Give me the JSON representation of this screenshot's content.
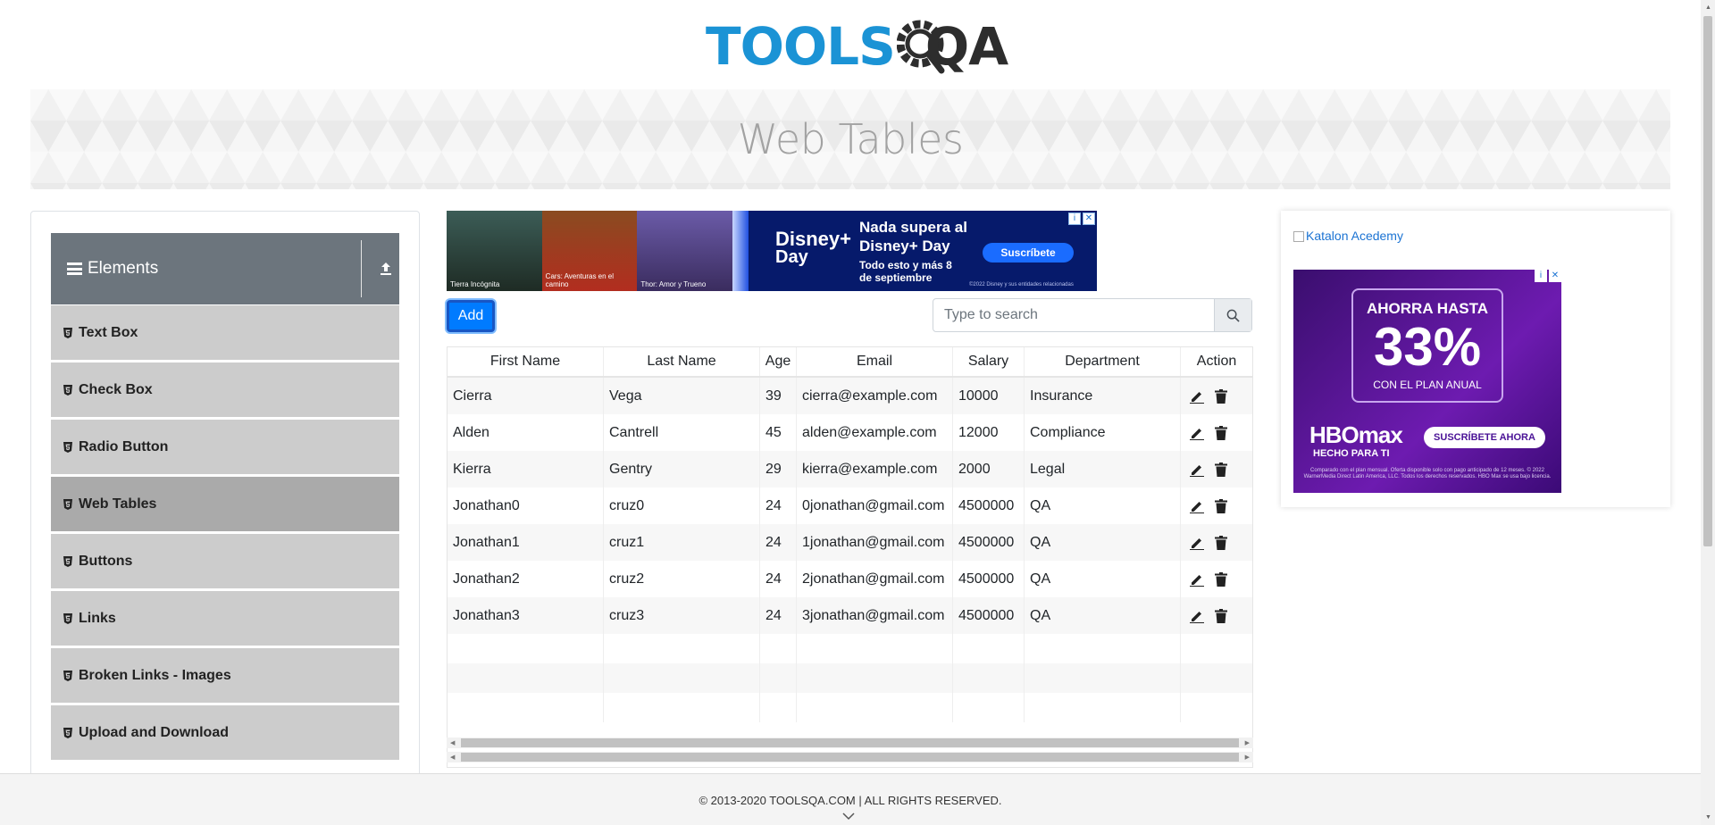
{
  "logo": {
    "part1": "TOOLS",
    "part2": "QA"
  },
  "page_title": "Web Tables",
  "sidebar": {
    "group_title": "Elements",
    "items": [
      {
        "label": "Text Box",
        "active": false
      },
      {
        "label": "Check Box",
        "active": false
      },
      {
        "label": "Radio Button",
        "active": false
      },
      {
        "label": "Web Tables",
        "active": true
      },
      {
        "label": "Buttons",
        "active": false
      },
      {
        "label": "Links",
        "active": false
      },
      {
        "label": "Broken Links - Images",
        "active": false
      },
      {
        "label": "Upload and Download",
        "active": false
      }
    ]
  },
  "ad_top": {
    "posters": [
      "Tierra Incógnita",
      "Cars: Aventuras en el camino",
      "Thor: Amor y Trueno"
    ],
    "logo_line1": "Disney+",
    "logo_line2": "Day",
    "headline": "Nada supera al Disney+ Day",
    "sub": "Todo esto y más 8 de septiembre",
    "cta": "Suscríbete",
    "fine": "©2022 Disney y sus entidades relacionadas"
  },
  "toolbar": {
    "add_label": "Add",
    "search_placeholder": "Type to search"
  },
  "table": {
    "headers": [
      "First Name",
      "Last Name",
      "Age",
      "Email",
      "Salary",
      "Department",
      "Action"
    ],
    "rows": [
      [
        "Cierra",
        "Vega",
        "39",
        "cierra@example.com",
        "10000",
        "Insurance"
      ],
      [
        "Alden",
        "Cantrell",
        "45",
        "alden@example.com",
        "12000",
        "Compliance"
      ],
      [
        "Kierra",
        "Gentry",
        "29",
        "kierra@example.com",
        "2000",
        "Legal"
      ],
      [
        "Jonathan0",
        "cruz0",
        "24",
        "0jonathan@gmail.com",
        "4500000",
        "QA"
      ],
      [
        "Jonathan1",
        "cruz1",
        "24",
        "1jonathan@gmail.com",
        "4500000",
        "QA"
      ],
      [
        "Jonathan2",
        "cruz2",
        "24",
        "2jonathan@gmail.com",
        "4500000",
        "QA"
      ],
      [
        "Jonathan3",
        "cruz3",
        "24",
        "3jonathan@gmail.com",
        "4500000",
        "QA"
      ]
    ],
    "empty_rows": 3,
    "action_icons": [
      "pencil-icon",
      "trash-icon"
    ]
  },
  "right_ad": {
    "image_alt": "Katalon Acedemy",
    "promo_line1": "AHORRA HASTA",
    "promo_percent": "33%",
    "promo_line2": "CON EL PLAN ANUAL",
    "brand": "HBOmax",
    "tagline": "HECHO PARA TI",
    "cta": "SUSCRÍBETE AHORA",
    "fine": "Comparado con el plan mensual. Oferta disponible solo con pago anticipado de 12 meses. © 2022 WarnerMedia Direct Latin America, LLC. Todos los derechos reservados. HBO Max se usa bajo licencia."
  },
  "footer": {
    "text": "© 2013-2020 TOOLSQA.COM | ALL RIGHTS RESERVED."
  },
  "colors": {
    "brand_blue": "#1b93d5",
    "add_button": "#007bff",
    "sidebar_header": "#6c757d",
    "menu_item": "#cccccc",
    "menu_active": "#aaaaaa"
  }
}
